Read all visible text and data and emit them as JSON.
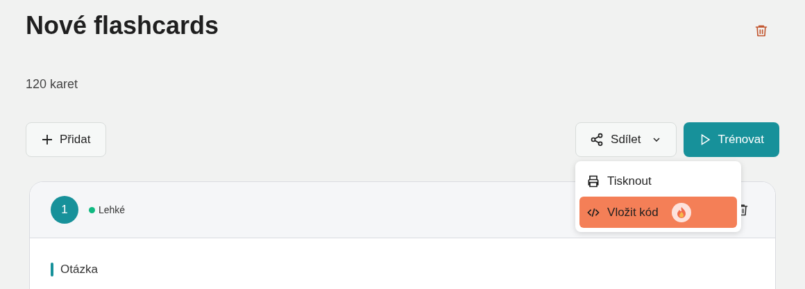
{
  "title": "Nové flashcards",
  "count": "120 karet",
  "add_button": {
    "label": "Přidat"
  },
  "share_button": {
    "label": "Sdílet",
    "expanded": true
  },
  "train_button": {
    "label": "Trénovat"
  },
  "share_menu": [
    {
      "kind": "print",
      "label": "Tisknout",
      "selected": false,
      "badge": false
    },
    {
      "kind": "embed",
      "label": "Vložit kód",
      "selected": true,
      "badge": true
    }
  ],
  "card": {
    "number": "1",
    "difficulty": {
      "label": "Lehké",
      "color": "#10b981"
    },
    "question_label": "Otázka"
  }
}
